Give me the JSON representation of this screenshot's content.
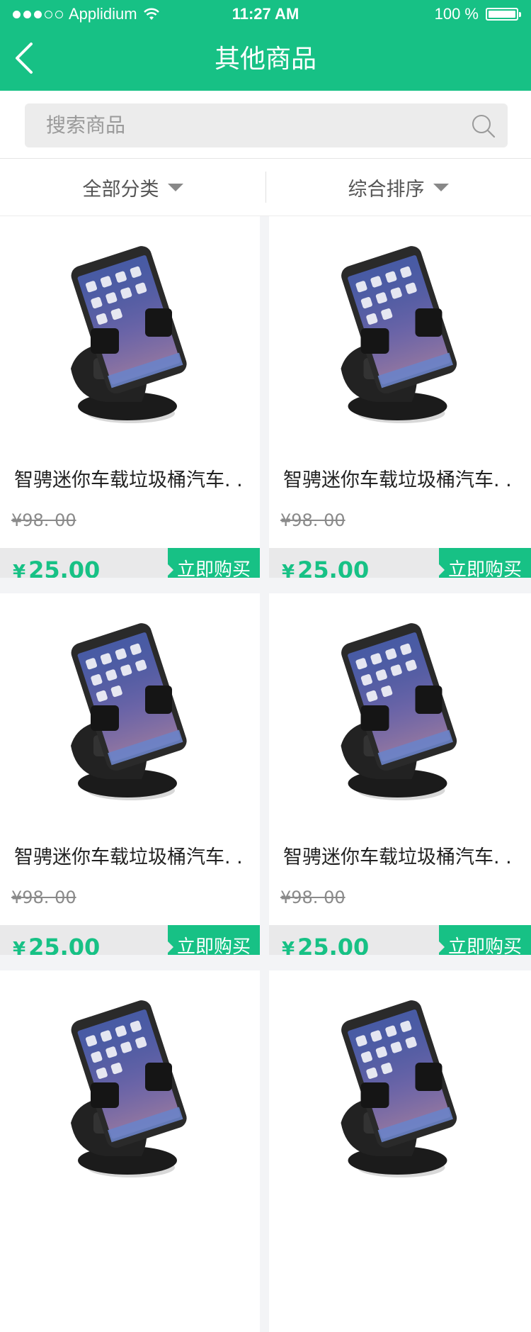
{
  "status_bar": {
    "carrier": "Applidium",
    "time": "11:27 AM",
    "battery": "100 %"
  },
  "nav": {
    "title": "其他商品",
    "back_icon": "chevron-left-icon"
  },
  "search": {
    "placeholder": "搜索商品",
    "icon": "search-icon"
  },
  "filters": [
    {
      "label": "全部分类",
      "icon": "caret-down-icon"
    },
    {
      "label": "综合排序",
      "icon": "caret-down-icon"
    }
  ],
  "products": [
    {
      "title": "智骋迷你车载垃圾桶汽车. .",
      "old_price": "¥98. 00",
      "currency": "¥",
      "price": "25.00",
      "buy_label": "立即购买"
    },
    {
      "title": "智骋迷你车载垃圾桶汽车. .",
      "old_price": "¥98. 00",
      "currency": "¥",
      "price": "25.00",
      "buy_label": "立即购买"
    },
    {
      "title": "智骋迷你车载垃圾桶汽车. .",
      "old_price": "¥98. 00",
      "currency": "¥",
      "price": "25.00",
      "buy_label": "立即购买"
    },
    {
      "title": "智骋迷你车载垃圾桶汽车. .",
      "old_price": "¥98. 00",
      "currency": "¥",
      "price": "25.00",
      "buy_label": "立即购买"
    },
    {
      "title": "",
      "old_price": "",
      "currency": "",
      "price": "",
      "buy_label": ""
    },
    {
      "title": "",
      "old_price": "",
      "currency": "",
      "price": "",
      "buy_label": ""
    }
  ],
  "colors": {
    "accent": "#17c185",
    "price_bar": "#e9e9ea",
    "background": "#f3f4f6"
  }
}
